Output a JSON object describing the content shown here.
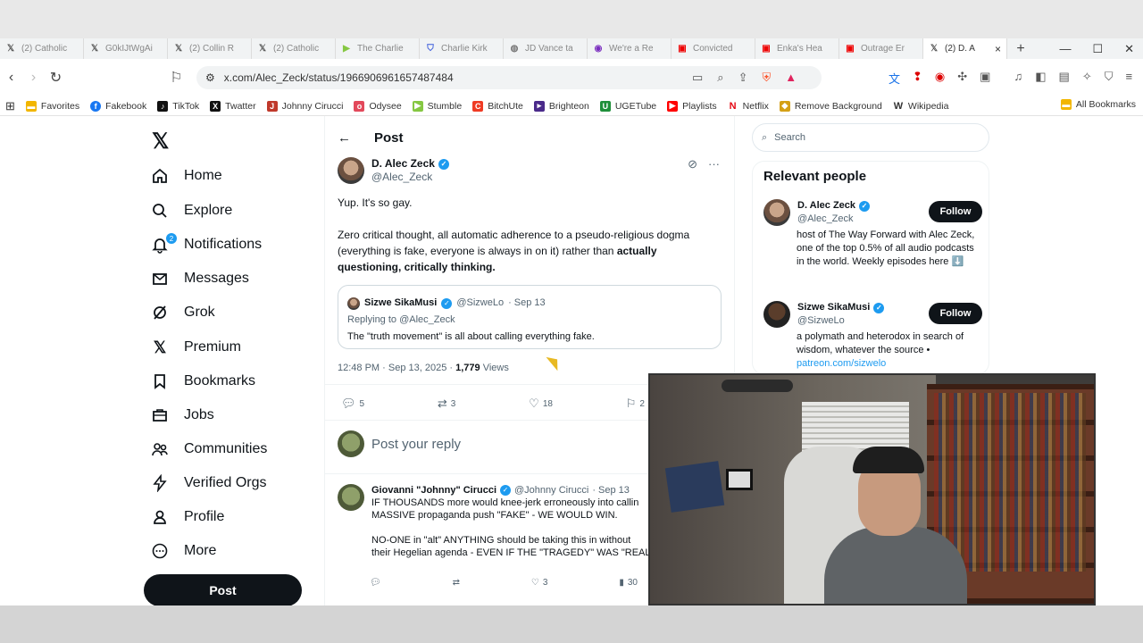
{
  "tabs": [
    {
      "label": "(2) Catholic",
      "icon": "x-icon"
    },
    {
      "label": "G0kIJtWgAi",
      "icon": "x-icon"
    },
    {
      "label": "(2) Collin R",
      "icon": "x-icon"
    },
    {
      "label": "(2) Catholic",
      "icon": "x-icon"
    },
    {
      "label": "The Charlie",
      "icon": "rumble-icon"
    },
    {
      "label": "Charlie Kirk",
      "icon": "shield-icon"
    },
    {
      "label": "JD Vance ta",
      "icon": "globe-icon"
    },
    {
      "label": "We're a Re",
      "icon": "odysee-icon"
    },
    {
      "label": "Convicted",
      "icon": "youtube-icon"
    },
    {
      "label": "Enka's Hea",
      "icon": "youtube-icon"
    },
    {
      "label": "Outrage Er",
      "icon": "youtube-icon"
    },
    {
      "label": "(2) D. A",
      "icon": "x-icon",
      "active": true
    }
  ],
  "address": {
    "url": "x.com/Alec_Zeck/status/1966906961657487484"
  },
  "bookmarks": [
    {
      "label": "Favorites",
      "color": "#f2b600"
    },
    {
      "label": "Fakebook",
      "color": "#1877f2"
    },
    {
      "label": "TikTok",
      "color": "#111111"
    },
    {
      "label": "Twatter",
      "color": "#111111"
    },
    {
      "label": "Johnny Cirucci",
      "color": "#c0392b"
    },
    {
      "label": "Odysee",
      "color": "#e2495b"
    },
    {
      "label": "Stumble",
      "color": "#85c742"
    },
    {
      "label": "BitchUte",
      "color": "#ef3b24"
    },
    {
      "label": "Brighteon",
      "color": "#4a2a8a"
    },
    {
      "label": "UGETube",
      "color": "#1f8f3a"
    },
    {
      "label": "Playlists",
      "color": "#ff0000"
    },
    {
      "label": "Netflix",
      "color": "#e50914"
    },
    {
      "label": "Remove Background",
      "color": "#d4a017"
    },
    {
      "label": "Wikipedia",
      "color": "#333333"
    }
  ],
  "all_bookmarks": "All Bookmarks",
  "nav": {
    "items": [
      "Home",
      "Explore",
      "Notifications",
      "Messages",
      "Grok",
      "Premium",
      "Bookmarks",
      "Jobs",
      "Communities",
      "Verified Orgs",
      "Profile",
      "More"
    ],
    "notif_badge": "2",
    "post_label": "Post"
  },
  "post": {
    "header": "Post",
    "author_name": "D. Alec Zeck",
    "author_handle": "@Alec_Zeck",
    "line1": "Yup. It's so gay.",
    "line2": "Zero critical thought, all automatic adherence to a pseudo-religious dogma (everything is fake, everyone is always in on it) rather than",
    "line2_bold": "actually questioning, critically thinking.",
    "quote": {
      "name": "Sizwe SikaMusi",
      "handle": "@SizweLo",
      "date": "· Sep 13",
      "replying": "Replying to @Alec_Zeck",
      "text": "The \"truth movement\" is all about calling everything fake."
    },
    "time": "12:48 PM · Sep 13, 2025 ·",
    "views_count": "1,779",
    "views_label": "Views",
    "replies": "5",
    "reposts": "3",
    "likes": "18",
    "bookmarks": "2",
    "reply_placeholder": "Post your reply"
  },
  "reply": {
    "name": "Giovanni \"Johnny\" Cirucci",
    "handle": "@Johnny Cirucci",
    "date": "· Sep 13",
    "line1": "IF THOUSANDS more would knee-jerk erroneously into callin",
    "line2": "MASSIVE propaganda push \"FAKE\" - WE WOULD WIN.",
    "line3": "NO-ONE in \"alt\" ANYTHING should be taking this in without",
    "line4": "their Hegelian agenda - EVEN IF THE \"TRAGEDY\" WAS \"REAL",
    "likes": "3",
    "views": "30"
  },
  "right": {
    "search_placeholder": "Search",
    "relevant_title": "Relevant people",
    "people": [
      {
        "name": "D. Alec Zeck",
        "handle": "@Alec_Zeck",
        "follow": "Follow",
        "bio": "host of The Way Forward with Alec Zeck, one of the top 0.5% of all audio podcasts in the world. Weekly episodes here ⬇️"
      },
      {
        "name": "Sizwe SikaMusi",
        "handle": "@SizweLo",
        "follow": "Follow",
        "bio": "a polymath and heterodox in search of wisdom, whatever the source •",
        "link": "patreon.com/sizwelo"
      }
    ]
  },
  "colors": {
    "accent": "#1d9bf0",
    "text": "#0f1419",
    "muted": "#536471"
  }
}
